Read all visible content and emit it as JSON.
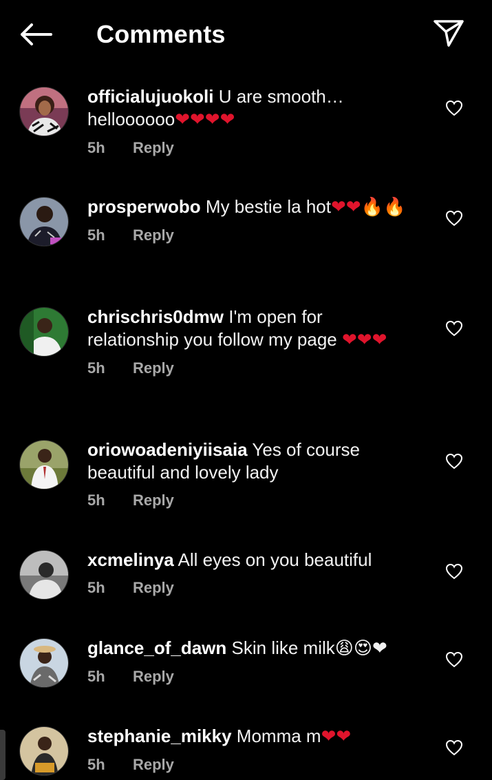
{
  "header": {
    "title": "Comments"
  },
  "icons": {
    "back": "arrow-left-icon",
    "share": "paper-plane-icon",
    "like": "heart-outline-icon"
  },
  "colors": {
    "background": "#000000",
    "text": "#ffffff",
    "muted": "#a8a8a8",
    "heart": "#e0142c"
  },
  "comments": [
    {
      "username": "officialujuokoli",
      "text": "U are smooth… helloooooo",
      "emojis": "❤❤❤❤",
      "time": "5h",
      "reply": "Reply"
    },
    {
      "username": "prosperwobo",
      "text": "My bestie la hot",
      "emojis": "❤❤🔥🔥",
      "time": "5h",
      "reply": "Reply"
    },
    {
      "username": "chrischris0dmw",
      "text": "I'm open for relationship you follow my page",
      "emojis": "❤❤❤",
      "time": "5h",
      "reply": "Reply"
    },
    {
      "username": "oriowoadeniyiisaia",
      "text": "Yes of course beautiful and lovely lady",
      "emojis": "",
      "time": "5h",
      "reply": "Reply"
    },
    {
      "username": "xcmelinya",
      "text": "All eyes on you beautiful",
      "emojis": "",
      "time": "5h",
      "reply": "Reply"
    },
    {
      "username": "glance_of_dawn",
      "text": "Skin like milk",
      "emojis": "😩😍❤",
      "time": "5h",
      "reply": "Reply"
    },
    {
      "username": "stephanie_mikky",
      "text": "Momma m",
      "emojis": "❤❤",
      "time": "5h",
      "reply": "Reply"
    }
  ]
}
